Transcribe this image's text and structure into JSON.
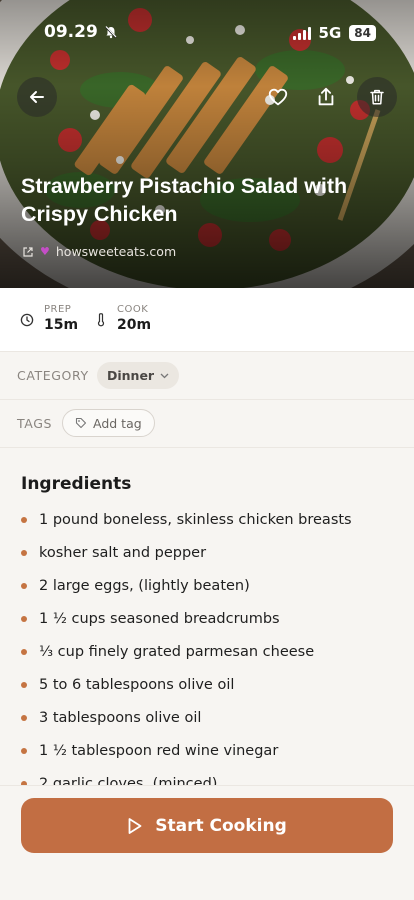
{
  "status_bar": {
    "time": "09.29",
    "network": "5G",
    "battery": "84"
  },
  "recipe": {
    "title": "Strawberry Pistachio Salad with Crispy Chicken",
    "source": "howsweeteats.com"
  },
  "times": {
    "prep_label": "PREP",
    "prep_value": "15m",
    "cook_label": "COOK",
    "cook_value": "20m"
  },
  "category": {
    "label": "CATEGORY",
    "value": "Dinner"
  },
  "tags": {
    "label": "TAGS",
    "add_label": "Add tag"
  },
  "ingredients": {
    "heading": "Ingredients",
    "items": [
      "1 pound boneless, skinless chicken breasts",
      "kosher salt and pepper",
      "2 large eggs, (lightly beaten)",
      "1 ½ cups seasoned breadcrumbs",
      "⅓ cup finely grated parmesan cheese",
      "5 to 6 tablespoons olive oil",
      "3 tablespoons olive oil",
      "1 ½ tablespoon red wine vinegar",
      "2 garlic cloves, (minced)"
    ]
  },
  "actions": {
    "start_cooking": "Start Cooking"
  },
  "colors": {
    "accent": "#c26e43",
    "bullet": "#c57442",
    "background": "#f7f5f2"
  },
  "icons": [
    "back-arrow-icon",
    "heart-icon",
    "share-icon",
    "trash-icon",
    "external-link-icon",
    "clock-icon",
    "thermometer-icon",
    "chevron-down-icon",
    "tag-icon",
    "play-icon",
    "bell-slash-icon"
  ]
}
